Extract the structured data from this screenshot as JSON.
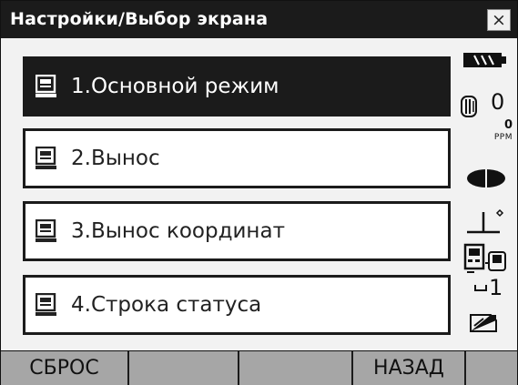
{
  "window": {
    "title": "Настройки/Выбор экрана",
    "close_glyph": "×"
  },
  "menu": {
    "items": [
      {
        "label": "1.Основной режим",
        "selected": true,
        "icon": "screen-config-icon"
      },
      {
        "label": "2.Вынос",
        "selected": false,
        "icon": "screen-config-icon"
      },
      {
        "label": "3.Вынос координат",
        "selected": false,
        "icon": "screen-config-icon"
      },
      {
        "label": "4.Строка статуса",
        "selected": false,
        "icon": "screen-config-icon"
      }
    ]
  },
  "status": {
    "battery_icon": "battery-icon",
    "prism_icon": "prism-icon",
    "prism_constant": "0",
    "ppm_value": "0",
    "ppm_label": "PPM",
    "target_icon": "target-icon",
    "tilt_icon": "tilt-icon",
    "comm_icon": "communication-icon",
    "input_mode": "1",
    "sd_icon": "memory-card-icon"
  },
  "softkeys": [
    {
      "label": "СБРОС"
    },
    {
      "label": ""
    },
    {
      "label": ""
    },
    {
      "label": "НАЗАД"
    },
    {
      "label": ""
    }
  ],
  "colors": {
    "titlebar": "#1b1b1b",
    "selected_item": "#1b1b1b",
    "softkey_bar": "#a6a6a6",
    "background": "#f2f2f2"
  }
}
